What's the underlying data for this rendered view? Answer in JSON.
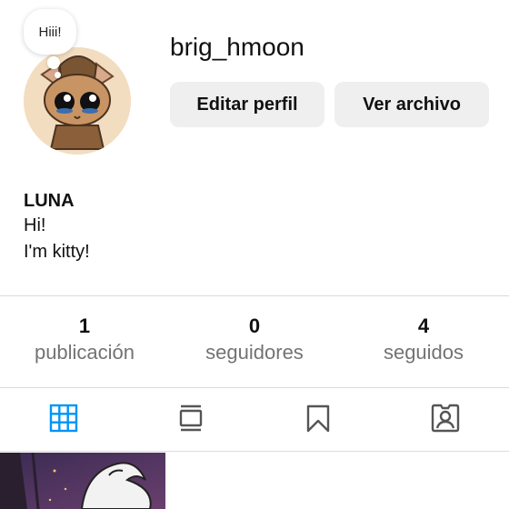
{
  "profile": {
    "username": "brig_hmoon",
    "note": "Hiii!",
    "avatar_icon": "cat-character-avatar"
  },
  "actions": {
    "edit_label": "Editar perfil",
    "archive_label": "Ver archivo"
  },
  "bio": {
    "name": "LUNA",
    "line1": "Hi!",
    "line2": "I'm kitty!"
  },
  "stats": [
    {
      "count": "1",
      "label": "publicación"
    },
    {
      "count": "0",
      "label": "seguidores"
    },
    {
      "count": "4",
      "label": "seguidos"
    }
  ],
  "tabs": [
    {
      "icon": "grid-icon",
      "active": true
    },
    {
      "icon": "feed-icon",
      "active": false
    },
    {
      "icon": "bookmark-icon",
      "active": false
    },
    {
      "icon": "tagged-icon",
      "active": false
    }
  ],
  "colors": {
    "accent": "#0095f6",
    "button_bg": "#efefef",
    "muted_text": "#737373",
    "divider": "#dbdbdb"
  }
}
